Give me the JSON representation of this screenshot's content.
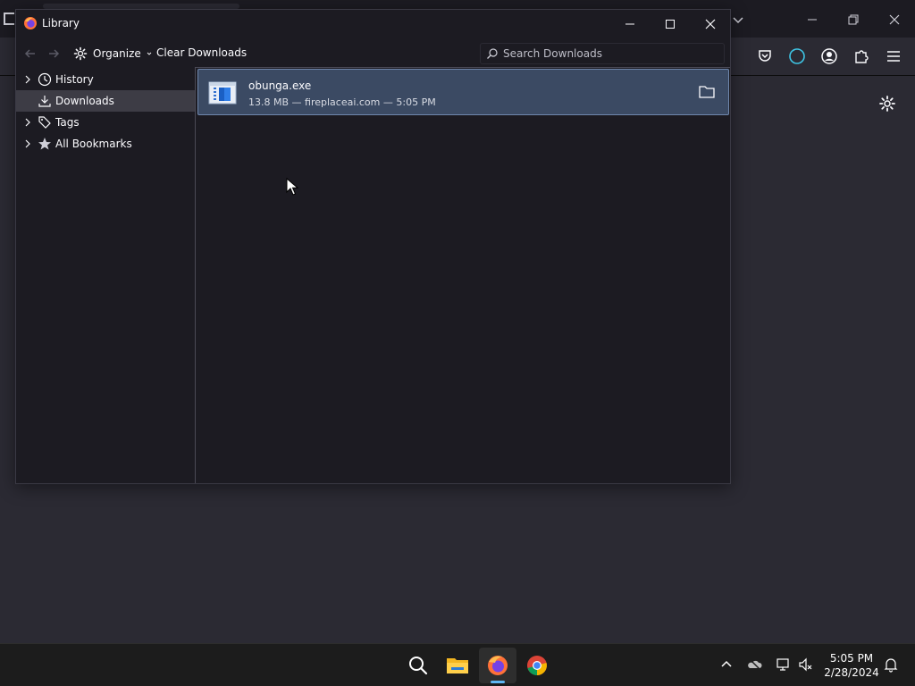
{
  "library": {
    "title": "Library",
    "toolbar": {
      "organize_label": "Organize",
      "clear_downloads_label": "Clear Downloads",
      "search_placeholder": "Search Downloads"
    },
    "sidebar": {
      "items": [
        {
          "label": "History",
          "icon": "clock-icon",
          "expandable": true
        },
        {
          "label": "Downloads",
          "icon": "download-icon",
          "expandable": false,
          "selected": true
        },
        {
          "label": "Tags",
          "icon": "tag-icon",
          "expandable": true
        },
        {
          "label": "All Bookmarks",
          "icon": "star-icon",
          "expandable": true
        }
      ]
    },
    "downloads": [
      {
        "file_name": "obunga.exe",
        "meta": "13.8 MB — fireplaceai.com — 5:05 PM"
      }
    ]
  },
  "taskbar": {
    "apps": [
      "search-icon",
      "file-explorer-icon",
      "firefox-icon",
      "chrome-icon"
    ],
    "clock": {
      "time": "5:05 PM",
      "date": "2/28/2024"
    }
  },
  "colors": {
    "window_bg": "#1c1b22",
    "content_bg": "#2b2a33",
    "selected_row": "#3b4a63",
    "selected_row_border": "#6f87ad",
    "sidebar_selected": "#3d3c45",
    "accent": "#5fb7f4"
  }
}
